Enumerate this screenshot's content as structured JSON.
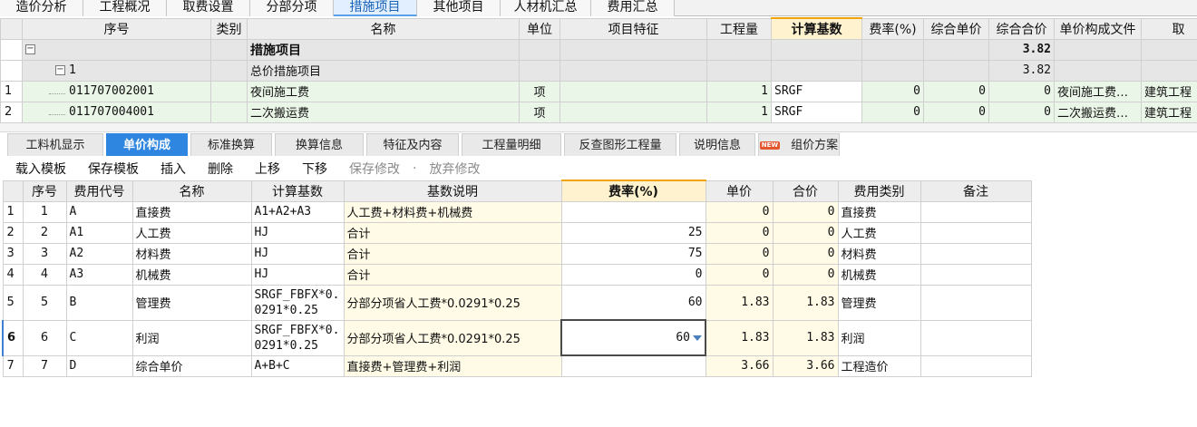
{
  "top_tabs": [
    "造价分析",
    "工程概况",
    "取费设置",
    "分部分项",
    "措施项目",
    "其他项目",
    "人材机汇总",
    "费用汇总"
  ],
  "top_tab_active": "措施项目",
  "upper_grid": {
    "columns": [
      "序号",
      "类别",
      "名称",
      "单位",
      "项目特征",
      "工程量",
      "计算基数",
      "费率(%)",
      "综合单价",
      "综合合价",
      "单价构成文件",
      "取"
    ],
    "rows": [
      {
        "num": "",
        "seq": "措施项目",
        "name": "措施项目",
        "total": "3.82"
      },
      {
        "num": "",
        "seq": "1",
        "name": "总价措施项目",
        "total": "3.82"
      },
      {
        "num": "1",
        "seq": "011707002001",
        "name": "夜间施工费",
        "unit": "项",
        "qty": "1",
        "base": "SRGF",
        "rate": "0",
        "unit_price": "0",
        "total": "0",
        "file": "夜间施工费…",
        "fee": "建筑工程"
      },
      {
        "num": "2",
        "seq": "011707004001",
        "name": "二次搬运费",
        "unit": "项",
        "qty": "1",
        "base": "SRGF",
        "rate": "0",
        "unit_price": "0",
        "total": "0",
        "file": "二次搬运费…",
        "fee": "建筑工程"
      }
    ]
  },
  "lower_tabs": [
    "工料机显示",
    "单价构成",
    "标准换算",
    "换算信息",
    "特征及内容",
    "工程量明细",
    "反查图形工程量",
    "说明信息",
    "组价方案"
  ],
  "lower_tab_active": "单价构成",
  "new_badge": "NEW",
  "toolbar": [
    "载入模板",
    "保存模板",
    "插入",
    "删除",
    "上移",
    "下移",
    "保存修改",
    "放弃修改"
  ],
  "lower_grid": {
    "columns": [
      "序号",
      "费用代号",
      "名称",
      "计算基数",
      "基数说明",
      "费率(%)",
      "单价",
      "合价",
      "费用类别",
      "备注"
    ],
    "rows": [
      {
        "num": "1",
        "seq": "1",
        "code": "A",
        "name": "直接费",
        "base": "A1+A2+A3",
        "desc": "人工费+材料费+机械费",
        "rate": "",
        "price": "0",
        "total": "0",
        "category": "直接费"
      },
      {
        "num": "2",
        "seq": "2",
        "code": "A1",
        "name": "人工费",
        "base": "HJ",
        "desc": "合计",
        "rate": "25",
        "price": "0",
        "total": "0",
        "category": "人工费"
      },
      {
        "num": "3",
        "seq": "3",
        "code": "A2",
        "name": "材料费",
        "base": "HJ",
        "desc": "合计",
        "rate": "75",
        "price": "0",
        "total": "0",
        "category": "材料费"
      },
      {
        "num": "4",
        "seq": "4",
        "code": "A3",
        "name": "机械费",
        "base": "HJ",
        "desc": "合计",
        "rate": "0",
        "price": "0",
        "total": "0",
        "category": "机械费"
      },
      {
        "num": "5",
        "seq": "5",
        "code": "B",
        "name": "管理费",
        "base": "SRGF_FBFX*0.0291*0.25",
        "base_l1": "SRGF_FBFX*0.",
        "base_l2": "0291*0.25",
        "desc": "分部分项省人工费*0.0291*0.25",
        "rate": "60",
        "price": "1.83",
        "total": "1.83",
        "category": "管理费"
      },
      {
        "num": "6",
        "seq": "6",
        "code": "C",
        "name": "利润",
        "base": "SRGF_FBFX*0.0291*0.25",
        "base_l1": "SRGF_FBFX*0.",
        "base_l2": "0291*0.25",
        "desc": "分部分项省人工费*0.0291*0.25",
        "rate": "60",
        "price": "1.83",
        "total": "1.83",
        "category": "利润"
      },
      {
        "num": "7",
        "seq": "7",
        "code": "D",
        "name": "综合单价",
        "base": "A+B+C",
        "desc": "直接费+管理费+利润",
        "rate": "",
        "price": "3.66",
        "total": "3.66",
        "category": "工程造价"
      }
    ]
  },
  "colors": {
    "active_tab": "#2f86e0",
    "selected_header": "#fff3cf",
    "green_row": "#eaf6e7",
    "gray_row": "#e6e6e6"
  }
}
